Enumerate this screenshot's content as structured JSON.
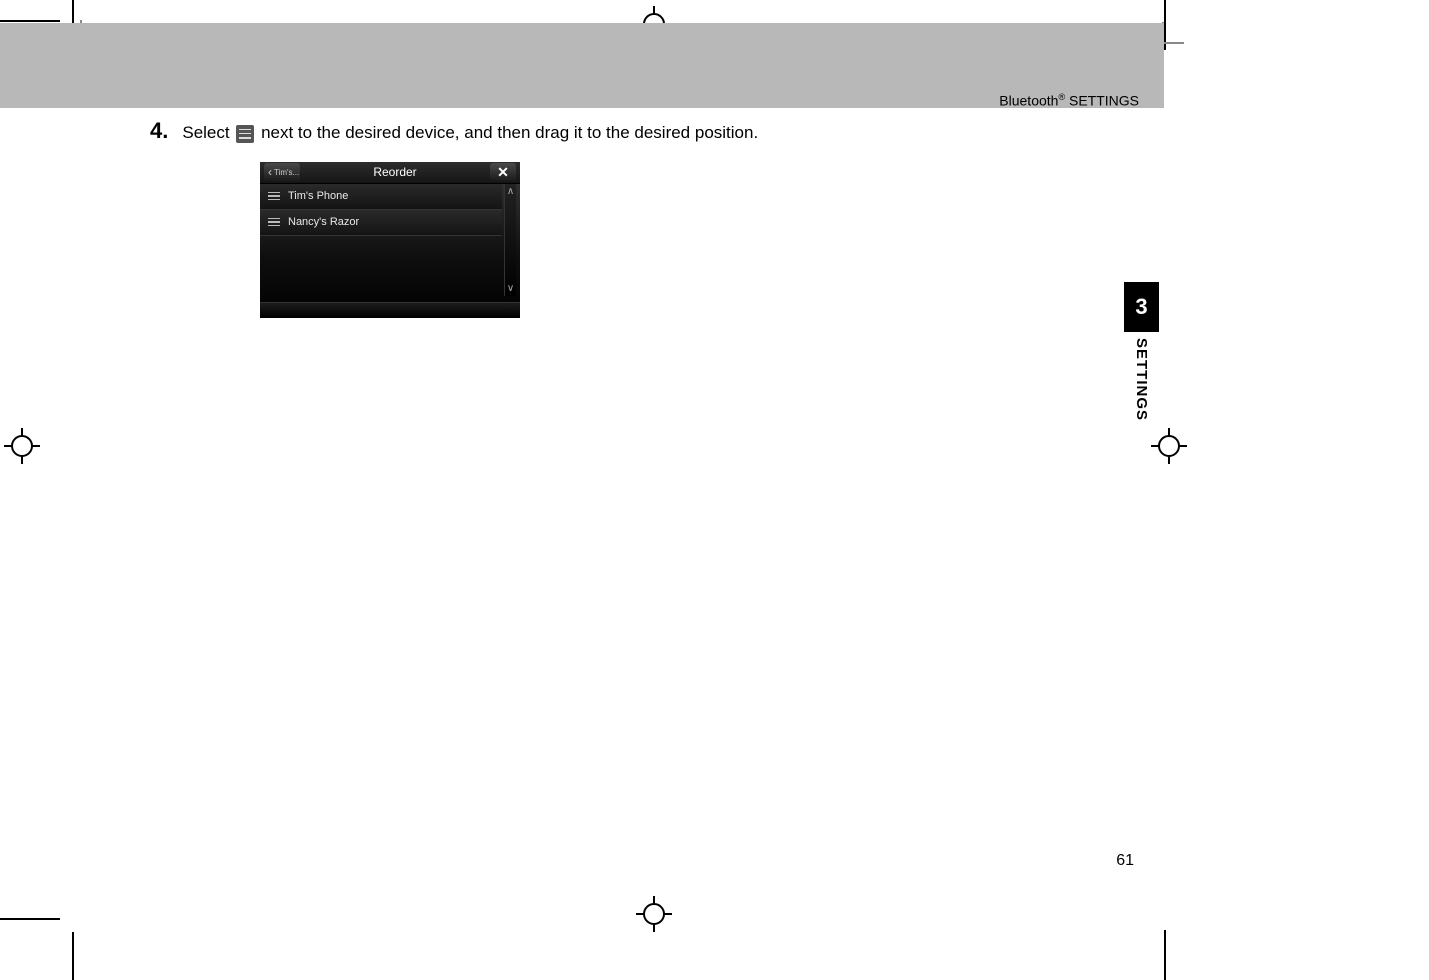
{
  "header": {
    "breadcrumb_prefix": "Bluetooth",
    "breadcrumb_reg": "®",
    "breadcrumb_suffix": " SETTINGS"
  },
  "step": {
    "number": "4.",
    "text_before_icon": "Select ",
    "text_after_icon": " next to the desired device, and then drag it to the desired position."
  },
  "screen": {
    "back_label": "Tim's...",
    "title": "Reorder",
    "close_symbol": "✕",
    "devices": [
      {
        "name": "Tim's Phone"
      },
      {
        "name": "Nancy's Razor"
      }
    ],
    "scroll_up": "∧",
    "scroll_down": "∨"
  },
  "side_tab": {
    "number": "3",
    "label": "SETTINGS"
  },
  "page_number": "61"
}
